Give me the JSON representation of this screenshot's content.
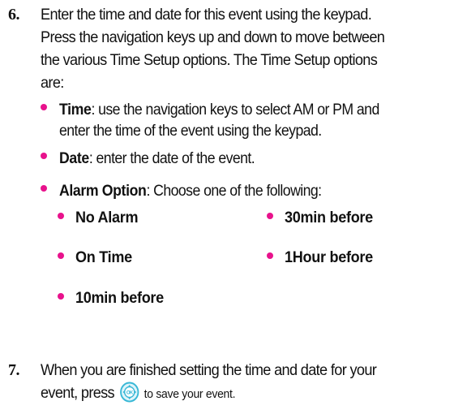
{
  "step6": {
    "number": "6.",
    "line1": "Enter the time and date for this event using the keypad.",
    "line2": "Press the navigation keys up and down to move between",
    "line3": "the various Time Setup options. The Time Setup options",
    "line4": "are:"
  },
  "bullets": [
    {
      "term": "Time",
      "text1": ": use the navigation keys to select AM or PM and",
      "text2": "enter the time of the event using the keypad."
    },
    {
      "term": "Date",
      "text1": ": enter the date of the event."
    },
    {
      "term": "Alarm Option",
      "text1": ": Choose one of the following:"
    }
  ],
  "alarm_options": [
    "No Alarm",
    "30min before",
    "On Time",
    "1Hour before",
    "10min before"
  ],
  "step7": {
    "number": "7.",
    "line1": "When you are finished setting the time and date for your",
    "line2_pre": "event, press",
    "line2_post": "to save your event."
  },
  "icons": {
    "ok_button": "ok-key-icon"
  },
  "colors": {
    "bullet": "#e8128c",
    "ok_icon": "#39b8d6"
  }
}
